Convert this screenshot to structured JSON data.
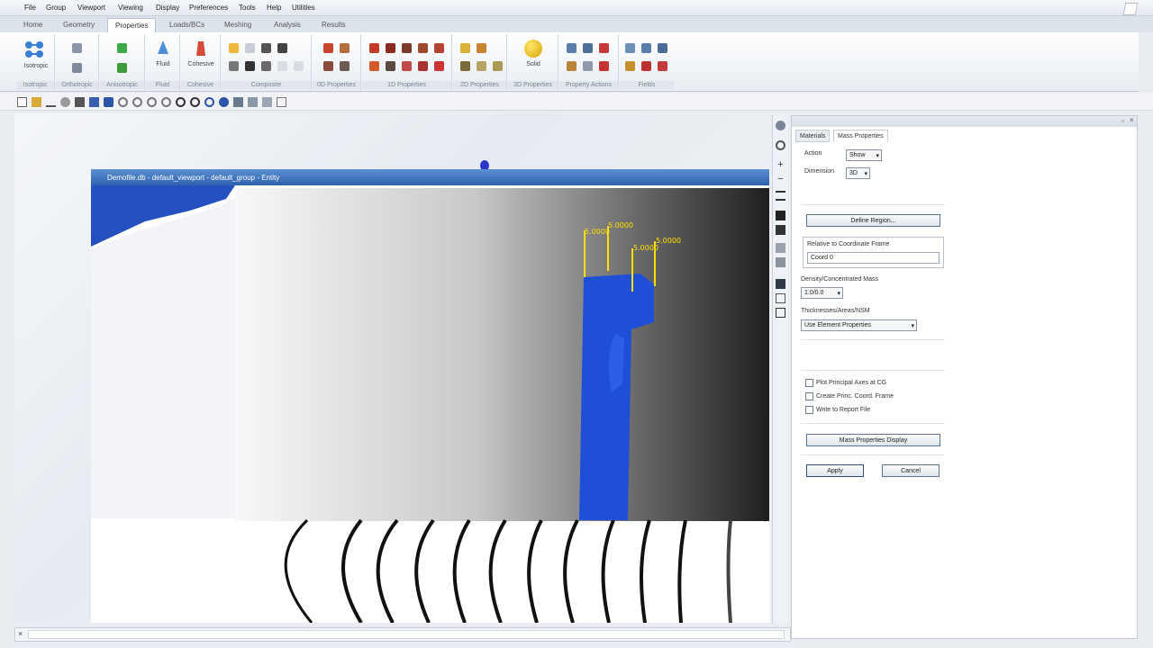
{
  "menu": [
    "File",
    "Group",
    "Viewport",
    "Viewing",
    "Display",
    "Preferences",
    "Tools",
    "Help",
    "Utilities"
  ],
  "tabs": [
    "Home",
    "Geometry",
    "Properties",
    "Loads/BCs",
    "Meshing",
    "Analysis",
    "Results"
  ],
  "ribbon": {
    "groups": [
      "Isotropic",
      "Orthotropic",
      "Anisotropic",
      "Fluid",
      "Cohesive",
      "Composite",
      "0D Properties",
      "1D Properties",
      "2D Properties",
      "3D Properties",
      "Property Actions",
      "Fields"
    ],
    "isotropic_label": "Isotropic",
    "fluid_label": "Fluid",
    "cohesive_label": "Cohesive",
    "solid_label": "Solid"
  },
  "viewport": {
    "title": "Demofile.db - default_viewport - default_group - Entity",
    "dims": [
      "5.0000",
      "5.0000",
      "5.0000",
      "5.0000"
    ]
  },
  "panel": {
    "tabs": [
      "Materials",
      "Mass Properties"
    ],
    "action_label": "Action",
    "action_value": "Show",
    "dimension_label": "Dimension",
    "dimension_value": "3D",
    "define_region": "Define Region...",
    "coord_frame_label": "Relative to Coordinate Frame",
    "coord_frame_value": "Coord 0",
    "density_label": "Density/Concentrated Mass",
    "density_value": "1.0/0.0",
    "thickness_label": "Thicknesses/Areas/NSM",
    "thickness_value": "Use Element Properties",
    "cb1": "Plot Principal Axes at CG",
    "cb2": "Create Princ. Coord. Frame",
    "cb3": "Write to Report File",
    "mass_display": "Mass Properties Display",
    "apply": "Apply",
    "cancel": "Cancel"
  },
  "colors": {
    "accent": "#2e62b0",
    "mesh": "#1f4fd6",
    "dim": "#ffe000"
  }
}
